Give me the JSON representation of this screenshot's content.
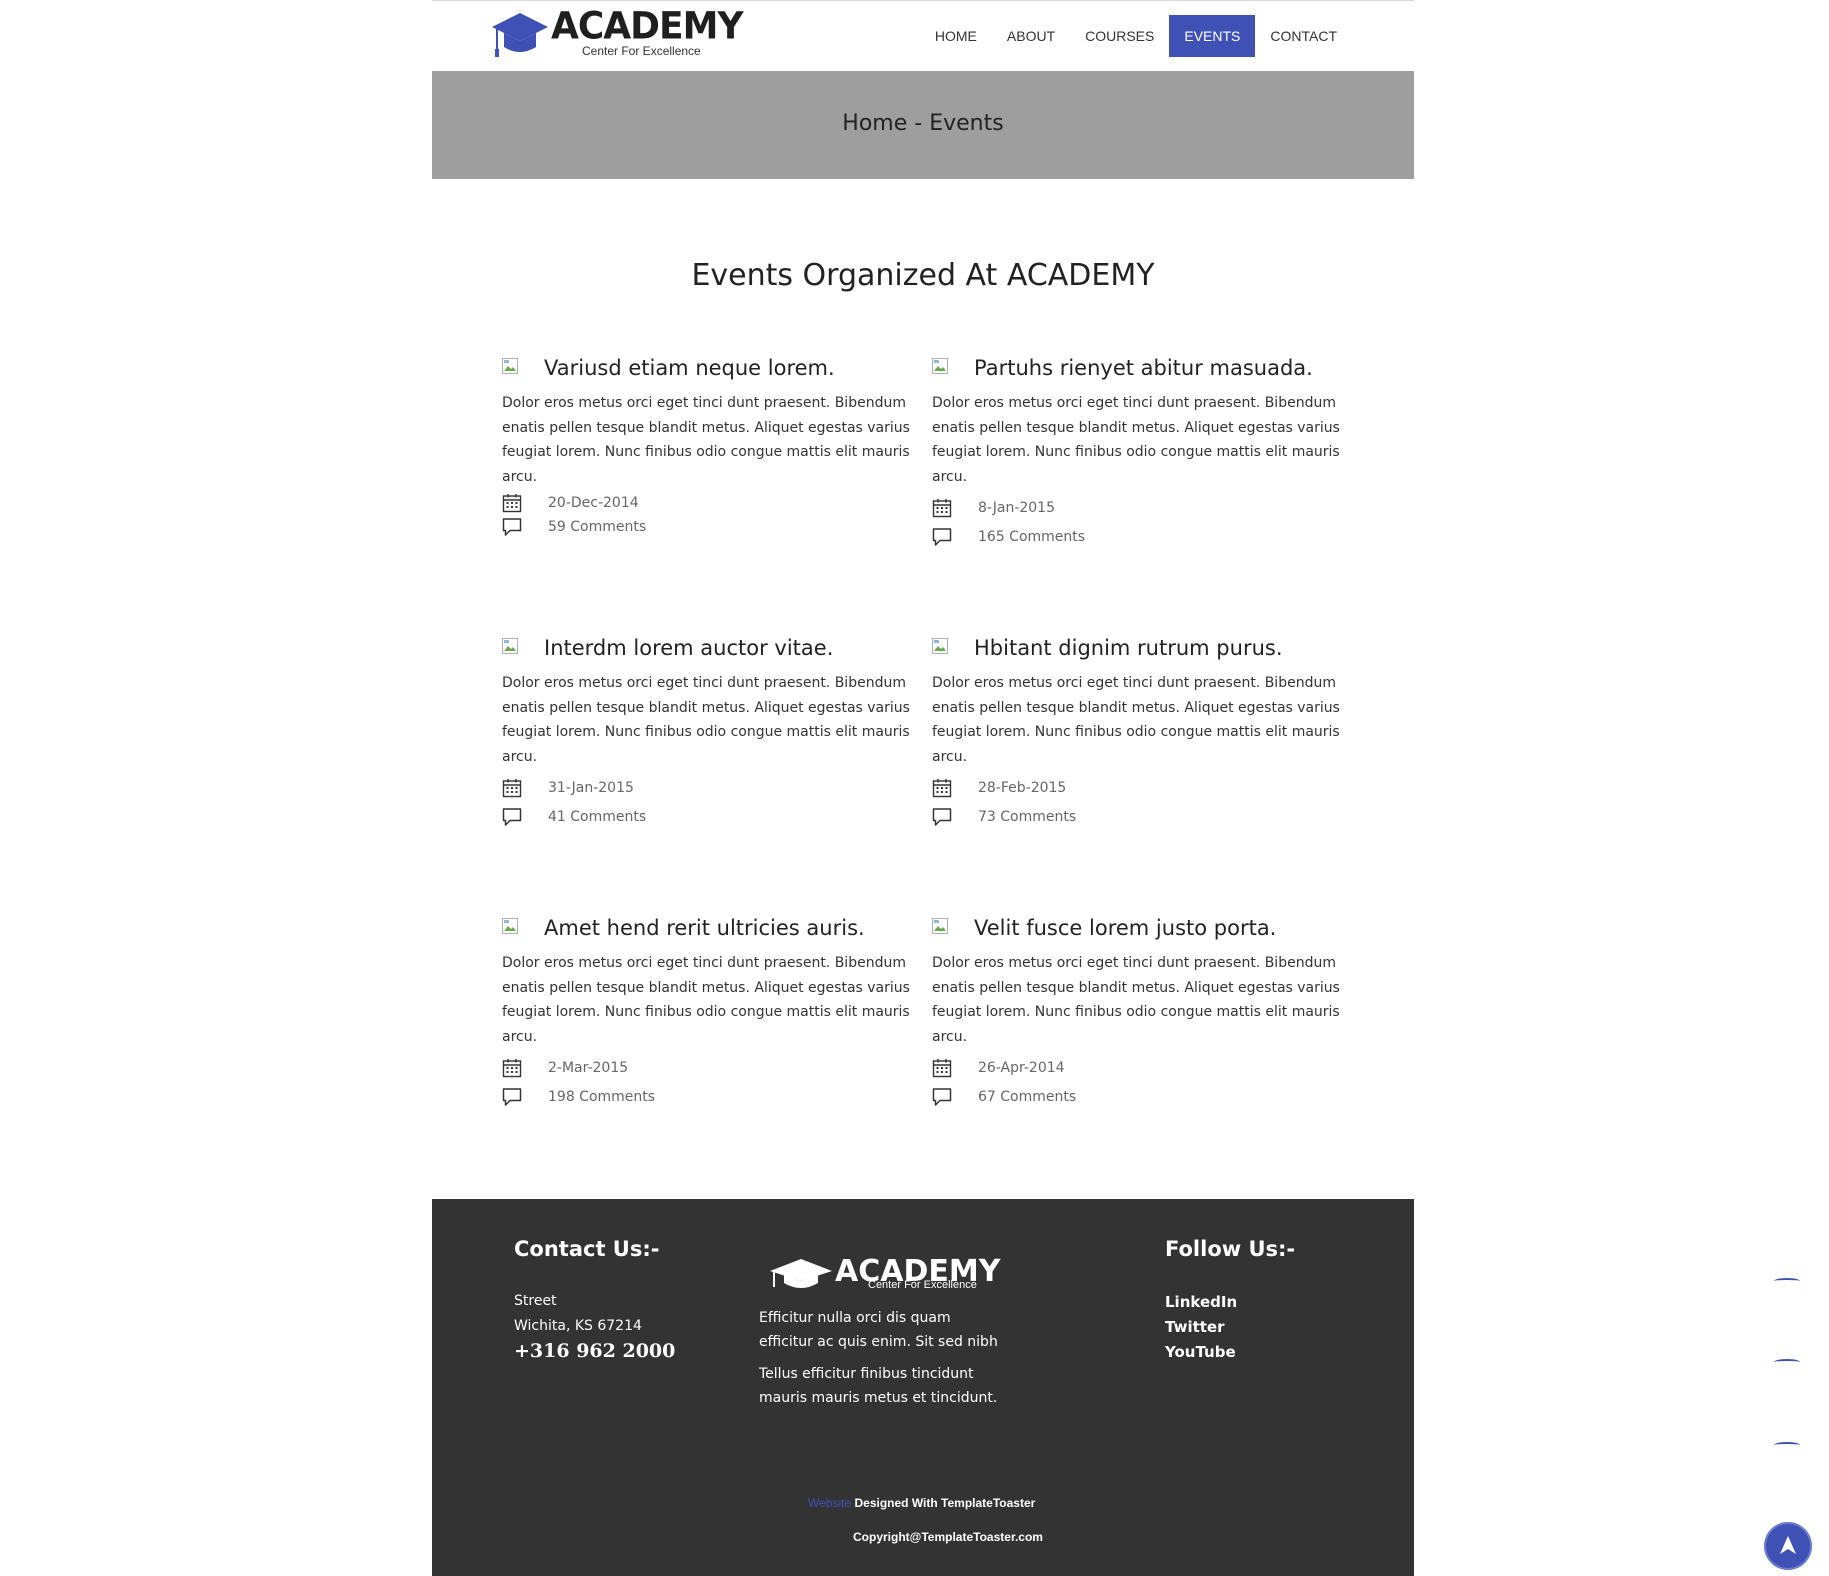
{
  "brand": {
    "name": "ACADEMY",
    "tagline": "Center For Excellence",
    "accent_color": "#3f51b5"
  },
  "nav": {
    "items": [
      {
        "label": "HOME",
        "active": false
      },
      {
        "label": "ABOUT",
        "active": false
      },
      {
        "label": "COURSES",
        "active": false
      },
      {
        "label": "EVENTS",
        "active": true
      },
      {
        "label": "CONTACT",
        "active": false
      }
    ]
  },
  "banner": {
    "breadcrumb": "Home - Events"
  },
  "main": {
    "title": "Events Organized At ACADEMY",
    "events": [
      {
        "title": "Variusd etiam neque lorem.",
        "lines": [
          "Dolor eros metus orci eget tinci dunt praesent. Bibendum",
          "enatis pellen tesque blandit metus. Aliquet egestas varius",
          "feugiat lorem. Nunc finibus odio congue mattis elit mauris",
          "arcu."
        ],
        "date": "20-Dec-2014",
        "comments": "59 Comments"
      },
      {
        "title": "Partuhs rienyet abitur masuada.",
        "lines": [
          "Dolor eros metus orci eget tinci dunt praesent. Bibendum",
          "enatis pellen tesque blandit metus. Aliquet egestas varius",
          "feugiat lorem. Nunc finibus odio congue mattis elit mauris",
          "arcu."
        ],
        "date": "8-Jan-2015",
        "comments": "165 Comments"
      },
      {
        "title": "Interdm lorem auctor vitae.",
        "lines": [
          "Dolor eros metus orci eget tinci dunt praesent. Bibendum",
          "enatis pellen tesque blandit metus. Aliquet egestas varius",
          "feugiat lorem. Nunc finibus odio congue mattis elit mauris",
          "arcu."
        ],
        "date": "31-Jan-2015",
        "comments": "41 Comments"
      },
      {
        "title": "Hbitant dignim rutrum purus.",
        "lines": [
          "Dolor eros metus orci eget tinci dunt praesent. Bibendum",
          "enatis pellen tesque blandit metus. Aliquet egestas varius",
          "feugiat lorem. Nunc finibus odio congue mattis elit mauris",
          "arcu."
        ],
        "date": "28-Feb-2015",
        "comments": "73 Comments"
      },
      {
        "title": "Amet hend rerit ultricies auris.",
        "lines": [
          "Dolor eros metus orci eget tinci dunt praesent. Bibendum",
          "enatis pellen tesque blandit metus. Aliquet egestas varius",
          "feugiat lorem. Nunc finibus odio congue mattis elit mauris",
          "arcu."
        ],
        "date": "2-Mar-2015",
        "comments": "198 Comments"
      },
      {
        "title": "Velit fusce lorem justo porta.",
        "lines": [
          "Dolor eros metus orci eget tinci dunt praesent. Bibendum",
          "enatis pellen tesque blandit metus. Aliquet egestas varius",
          "feugiat lorem. Nunc finibus odio congue mattis elit mauris",
          "arcu."
        ],
        "date": "26-Apr-2014",
        "comments": "67 Comments"
      }
    ]
  },
  "footer": {
    "contact": {
      "heading": "Contact Us:-",
      "address_line_1": "Street",
      "address_line_2": "Wichita, KS 67214",
      "phone": "+316 962 2000"
    },
    "about": {
      "brand": "ACADEMY",
      "tagline": "Center For Excellence",
      "para1_line1": "Efficitur nulla orci dis quam",
      "para1_line2": "efficitur ac quis enim. Sit sed nibh",
      "para2_line1": "Tellus efficitur  finibus tincidunt",
      "para2_line2": "mauris mauris metus et tincidunt."
    },
    "follow": {
      "heading": "Follow Us:-",
      "links": [
        "LinkedIn",
        "Twitter",
        "YouTube"
      ]
    },
    "credit_link": "Website",
    "credit_text": " Designed With TemplateToaster",
    "copyright": "Copyright@TemplateToaster.com"
  }
}
